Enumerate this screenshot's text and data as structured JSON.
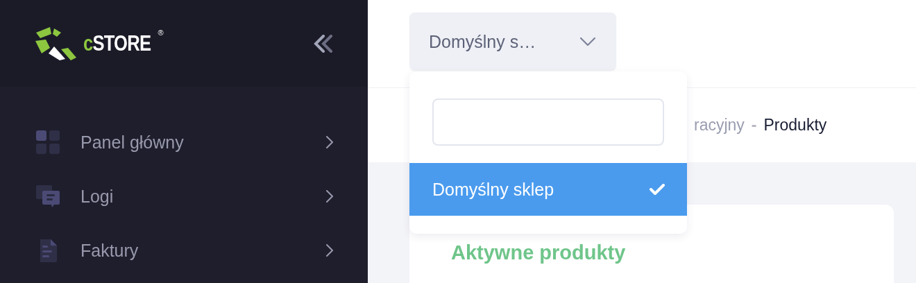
{
  "sidebar": {
    "logo": {
      "text": "cSTORE",
      "mark": "®"
    },
    "items": [
      {
        "label": "Panel główny",
        "kind": "grid"
      },
      {
        "label": "Logi",
        "kind": "chat"
      },
      {
        "label": "Faktury",
        "kind": "document"
      }
    ]
  },
  "store_select": {
    "value": "Domyślny s…",
    "expanded": true,
    "options": [
      {
        "label": "Domyślny sklep",
        "selected": true
      }
    ]
  },
  "breadcrumb": {
    "items": [
      "racyjny",
      "Produkty"
    ],
    "separator": "-"
  },
  "card": {
    "title": "Aktywne produkty"
  }
}
